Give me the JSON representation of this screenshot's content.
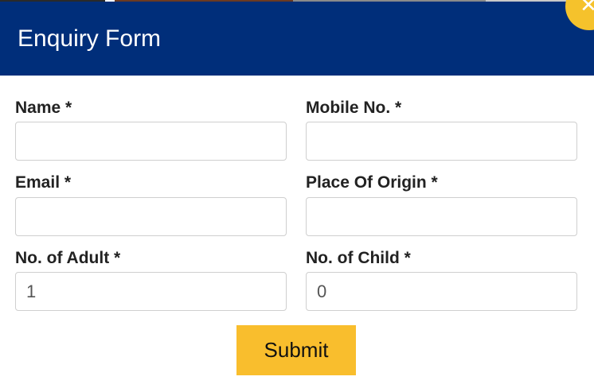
{
  "form": {
    "title": "Enquiry Form",
    "fields": {
      "name": {
        "label": "Name *",
        "value": ""
      },
      "mobile": {
        "label": "Mobile No. *",
        "value": ""
      },
      "email": {
        "label": "Email *",
        "value": ""
      },
      "origin": {
        "label": "Place Of Origin *",
        "value": ""
      },
      "adult": {
        "label": "No. of Adult *",
        "value": "1"
      },
      "child": {
        "label": "No. of Child *",
        "value": "0"
      }
    },
    "submit_label": "Submit"
  },
  "icons": {
    "close": "close-icon"
  },
  "colors": {
    "header_bg": "#002e7a",
    "accent": "#f9be2d",
    "close_bg": "#f5c22c",
    "title_text": "#ffffff",
    "label_text": "#222222",
    "input_border": "#cfcfcf",
    "input_text": "#555555"
  }
}
